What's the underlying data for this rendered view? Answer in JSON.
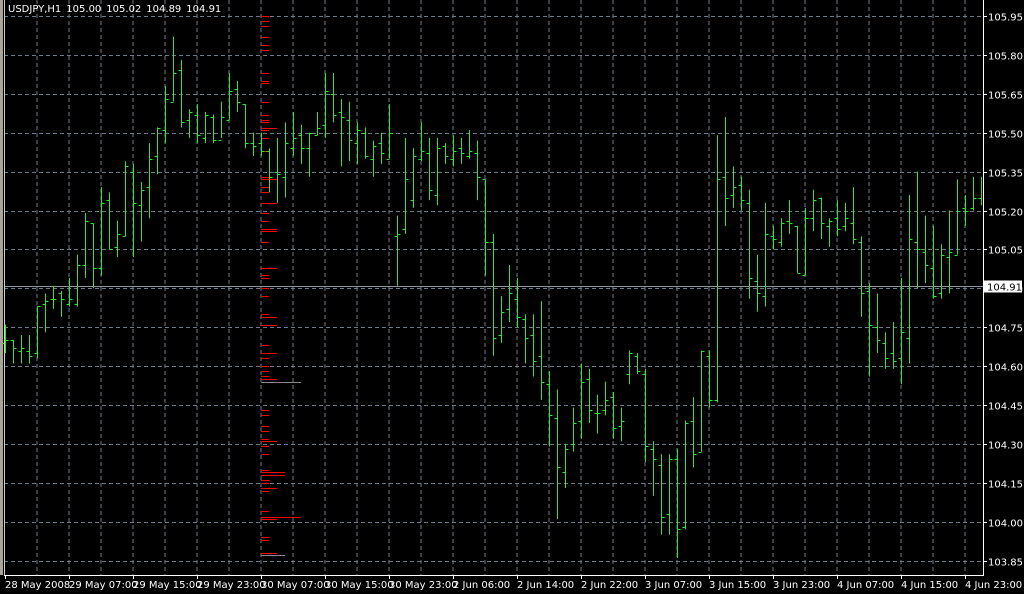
{
  "header": {
    "symbol": "USDJPY,H1",
    "open": "105.00",
    "high": "105.02",
    "low": "104.89",
    "close": "104.91"
  },
  "colors": {
    "background": "#000000",
    "bars": "#22ee22",
    "grid": "#6e7b8b",
    "axis": "#ffffff",
    "profile": "#ff0000",
    "profile_alt": "#8a8a8a",
    "price_line": "#8c96a4"
  },
  "chart_data": {
    "type": "bar",
    "style": "ohlc",
    "title": "USDJPY,H1",
    "ylim": [
      103.85,
      105.95
    ],
    "grid": true,
    "current_price": "104.91",
    "y_ticks": [
      "105.95",
      "105.80",
      "105.65",
      "105.50",
      "105.35",
      "105.20",
      "105.05",
      "104.90",
      "104.75",
      "104.60",
      "104.45",
      "104.30",
      "104.15",
      "104.00",
      "103.85"
    ],
    "x_ticks": [
      "28 May 2008",
      "29 May 07:00",
      "29 May 15:00",
      "29 May 23:00",
      "30 May 07:00",
      "30 May 15:00",
      "30 May 23:00",
      "2 Jun 06:00",
      "2 Jun 14:00",
      "2 Jun 22:00",
      "3 Jun 07:00",
      "3 Jun 15:00",
      "3 Jun 23:00",
      "4 Jun 07:00",
      "4 Jun 15:00",
      "4 Jun 23:00"
    ],
    "ohlc": [
      [
        104.69,
        104.76,
        104.65,
        104.7
      ],
      [
        104.7,
        104.7,
        104.61,
        104.67
      ],
      [
        104.66,
        104.72,
        104.61,
        104.67
      ],
      [
        104.66,
        104.72,
        104.61,
        104.64
      ],
      [
        104.65,
        104.83,
        104.63,
        104.83
      ],
      [
        104.84,
        104.88,
        104.73,
        104.85
      ],
      [
        104.86,
        104.91,
        104.82,
        104.86
      ],
      [
        104.88,
        104.89,
        104.79,
        104.86
      ],
      [
        104.84,
        104.94,
        104.83,
        104.86
      ],
      [
        104.84,
        105.03,
        104.83,
        104.99
      ],
      [
        104.99,
        105.19,
        104.94,
        105.16
      ],
      [
        105.15,
        105.15,
        104.9,
        104.98
      ],
      [
        104.98,
        105.29,
        104.95,
        105.23
      ],
      [
        105.24,
        105.27,
        105.05,
        105.05
      ],
      [
        105.06,
        105.16,
        105.02,
        105.11
      ],
      [
        105.1,
        105.39,
        105.1,
        105.37
      ],
      [
        105.35,
        105.38,
        105.02,
        105.23
      ],
      [
        105.22,
        105.31,
        105.08,
        105.28
      ],
      [
        105.29,
        105.46,
        105.17,
        105.4
      ],
      [
        105.41,
        105.52,
        105.34,
        105.52
      ],
      [
        105.51,
        105.68,
        105.46,
        105.63
      ],
      [
        105.62,
        105.87,
        105.62,
        105.73
      ],
      [
        105.74,
        105.78,
        105.52,
        105.54
      ],
      [
        105.55,
        105.59,
        105.48,
        105.58
      ],
      [
        105.57,
        105.61,
        105.46,
        105.49
      ],
      [
        105.48,
        105.58,
        105.46,
        105.57
      ],
      [
        105.56,
        105.57,
        105.46,
        105.47
      ],
      [
        105.47,
        105.62,
        105.48,
        105.56
      ],
      [
        105.55,
        105.73,
        105.55,
        105.66
      ],
      [
        105.67,
        105.7,
        105.58,
        105.62
      ],
      [
        105.61,
        105.61,
        105.44,
        105.46
      ],
      [
        105.46,
        105.5,
        105.41,
        105.45
      ],
      [
        105.46,
        105.5,
        105.41,
        105.43
      ],
      [
        105.43,
        105.44,
        105.27,
        105.33
      ],
      [
        105.35,
        105.48,
        105.23,
        105.34
      ],
      [
        105.33,
        105.54,
        105.25,
        105.46
      ],
      [
        105.44,
        105.58,
        105.41,
        105.48
      ],
      [
        105.49,
        105.53,
        105.38,
        105.44
      ],
      [
        105.44,
        105.5,
        105.33,
        105.5
      ],
      [
        105.49,
        105.58,
        105.49,
        105.52
      ],
      [
        105.53,
        105.73,
        105.48,
        105.66
      ],
      [
        105.65,
        105.73,
        105.54,
        105.57
      ],
      [
        105.58,
        105.63,
        105.37,
        105.56
      ],
      [
        105.55,
        105.62,
        105.39,
        105.47
      ],
      [
        105.46,
        105.54,
        105.38,
        105.51
      ],
      [
        105.5,
        105.52,
        105.4,
        105.41
      ],
      [
        105.4,
        105.47,
        105.33,
        105.45
      ],
      [
        105.46,
        105.5,
        105.38,
        105.42
      ],
      [
        105.4,
        105.61,
        105.4,
        105.5
      ],
      [
        105.1,
        105.18,
        104.91,
        105.11
      ],
      [
        105.13,
        105.48,
        105.11,
        105.32
      ],
      [
        105.24,
        105.44,
        105.21,
        105.41
      ],
      [
        105.4,
        105.54,
        105.39,
        105.43
      ],
      [
        105.42,
        105.48,
        105.24,
        105.28
      ],
      [
        105.26,
        105.48,
        105.22,
        105.44
      ],
      [
        105.45,
        105.46,
        105.38,
        105.41
      ],
      [
        105.4,
        105.49,
        105.37,
        105.43
      ],
      [
        105.44,
        105.48,
        105.38,
        105.42
      ],
      [
        105.41,
        105.51,
        105.4,
        105.43
      ],
      [
        105.42,
        105.47,
        105.24,
        105.33
      ],
      [
        105.32,
        105.32,
        104.95,
        105.08
      ],
      [
        105.08,
        105.11,
        104.64,
        104.71
      ],
      [
        104.72,
        104.87,
        104.69,
        104.81
      ],
      [
        104.82,
        104.99,
        104.77,
        104.88
      ],
      [
        104.86,
        104.94,
        104.75,
        104.79
      ],
      [
        104.78,
        104.8,
        104.61,
        104.71
      ],
      [
        104.72,
        104.8,
        104.56,
        104.62
      ],
      [
        104.64,
        104.85,
        104.47,
        104.54
      ],
      [
        104.53,
        104.58,
        104.29,
        104.41
      ],
      [
        104.4,
        104.51,
        104.01,
        104.21
      ],
      [
        104.19,
        104.3,
        104.13,
        104.28
      ],
      [
        104.3,
        104.44,
        104.27,
        104.38
      ],
      [
        104.39,
        104.61,
        104.32,
        104.54
      ],
      [
        104.55,
        104.59,
        104.38,
        104.43
      ],
      [
        104.42,
        104.49,
        104.34,
        104.42
      ],
      [
        104.43,
        104.54,
        104.41,
        104.47
      ],
      [
        104.48,
        104.5,
        104.32,
        104.36
      ],
      [
        104.37,
        104.44,
        104.31,
        104.39
      ],
      [
        104.57,
        104.66,
        104.53,
        104.65
      ],
      [
        104.64,
        104.65,
        104.57,
        104.58
      ],
      [
        104.57,
        104.59,
        104.23,
        104.29
      ],
      [
        104.28,
        104.31,
        104.1,
        104.24
      ],
      [
        104.22,
        104.26,
        103.95,
        104.02
      ],
      [
        104.03,
        104.26,
        103.95,
        104.24
      ],
      [
        104.24,
        104.28,
        103.86,
        103.97
      ],
      [
        103.98,
        104.39,
        103.97,
        104.38
      ],
      [
        104.39,
        104.48,
        104.21,
        104.26
      ],
      [
        104.27,
        104.66,
        104.27,
        104.66
      ],
      [
        104.64,
        104.66,
        104.44,
        104.47
      ],
      [
        104.47,
        105.49,
        104.46,
        105.32
      ],
      [
        105.33,
        105.56,
        105.14,
        105.25
      ],
      [
        105.26,
        105.37,
        105.21,
        105.29
      ],
      [
        105.3,
        105.33,
        105.2,
        105.24
      ],
      [
        105.23,
        105.28,
        104.86,
        104.94
      ],
      [
        104.93,
        105.03,
        104.81,
        104.88
      ],
      [
        104.87,
        105.23,
        104.83,
        105.11
      ],
      [
        105.1,
        105.14,
        105.05,
        105.09
      ],
      [
        105.08,
        105.17,
        105.06,
        105.15
      ],
      [
        105.16,
        105.24,
        105.11,
        105.15
      ],
      [
        105.14,
        105.14,
        104.96,
        104.96
      ],
      [
        104.95,
        105.21,
        104.95,
        105.17
      ],
      [
        105.17,
        105.28,
        105.12,
        105.24
      ],
      [
        105.25,
        105.25,
        105.09,
        105.15
      ],
      [
        105.14,
        105.17,
        105.06,
        105.16
      ],
      [
        105.17,
        105.24,
        105.1,
        105.13
      ],
      [
        105.14,
        105.23,
        105.12,
        105.17
      ],
      [
        105.15,
        105.29,
        105.07,
        105.09
      ],
      [
        105.08,
        105.1,
        104.79,
        104.88
      ],
      [
        104.89,
        104.92,
        104.56,
        104.76
      ],
      [
        104.75,
        104.88,
        104.65,
        104.7
      ],
      [
        104.69,
        104.73,
        104.59,
        104.63
      ],
      [
        104.65,
        104.77,
        104.59,
        104.62
      ],
      [
        104.63,
        104.94,
        104.53,
        104.73
      ],
      [
        104.71,
        105.26,
        104.61,
        105.09
      ],
      [
        105.08,
        105.35,
        104.9,
        105.05
      ],
      [
        105.04,
        105.18,
        104.92,
        104.99
      ],
      [
        104.98,
        105.14,
        104.86,
        104.87
      ],
      [
        104.88,
        105.07,
        104.86,
        105.03
      ],
      [
        105.02,
        105.2,
        104.88,
        105.04
      ],
      [
        105.03,
        105.32,
        105.03,
        105.2
      ],
      [
        105.21,
        105.26,
        105.14,
        105.2
      ],
      [
        105.21,
        105.33,
        105.2,
        105.25
      ],
      [
        105.25,
        105.33,
        105.22,
        105.28
      ]
    ],
    "profile": [
      [
        105.95,
        1
      ],
      [
        105.93,
        1
      ],
      [
        105.91,
        1
      ],
      [
        105.87,
        1
      ],
      [
        105.84,
        1
      ],
      [
        105.82,
        1
      ],
      [
        105.73,
        1
      ],
      [
        105.7,
        1
      ],
      [
        105.69,
        1
      ],
      [
        105.62,
        1
      ],
      [
        105.57,
        1
      ],
      [
        105.55,
        1
      ],
      [
        105.54,
        1
      ],
      [
        105.52,
        2
      ],
      [
        105.51,
        1
      ],
      [
        105.48,
        1
      ],
      [
        105.43,
        1
      ],
      [
        105.33,
        1
      ],
      [
        105.32,
        2
      ],
      [
        105.29,
        1
      ],
      [
        105.27,
        1
      ],
      [
        105.23,
        2
      ],
      [
        105.19,
        1
      ],
      [
        105.16,
        1
      ],
      [
        105.13,
        2
      ],
      [
        105.12,
        2
      ],
      [
        105.08,
        1
      ],
      [
        104.98,
        2
      ],
      [
        104.95,
        1
      ],
      [
        104.94,
        1
      ],
      [
        104.9,
        1
      ],
      [
        104.87,
        1
      ],
      [
        104.8,
        1
      ],
      [
        104.79,
        2
      ],
      [
        104.76,
        2
      ],
      [
        104.68,
        1
      ],
      [
        104.65,
        2
      ],
      [
        104.63,
        1
      ],
      [
        104.6,
        1
      ],
      [
        104.58,
        1
      ],
      [
        104.56,
        1
      ],
      [
        104.55,
        2
      ],
      [
        104.54,
        5,
        "alt"
      ],
      [
        104.43,
        1
      ],
      [
        104.41,
        1
      ],
      [
        104.37,
        1
      ],
      [
        104.35,
        1
      ],
      [
        104.32,
        1
      ],
      [
        104.31,
        2
      ],
      [
        104.29,
        1
      ],
      [
        104.26,
        1
      ],
      [
        104.2,
        1
      ],
      [
        104.19,
        3
      ],
      [
        104.18,
        3
      ],
      [
        104.16,
        1
      ],
      [
        104.15,
        1
      ],
      [
        104.13,
        2
      ],
      [
        104.12,
        1
      ],
      [
        104.04,
        1
      ],
      [
        104.02,
        5
      ],
      [
        104.01,
        2
      ],
      [
        103.94,
        1
      ],
      [
        103.93,
        1
      ],
      [
        103.88,
        2
      ],
      [
        103.87,
        3,
        "alt"
      ]
    ]
  }
}
